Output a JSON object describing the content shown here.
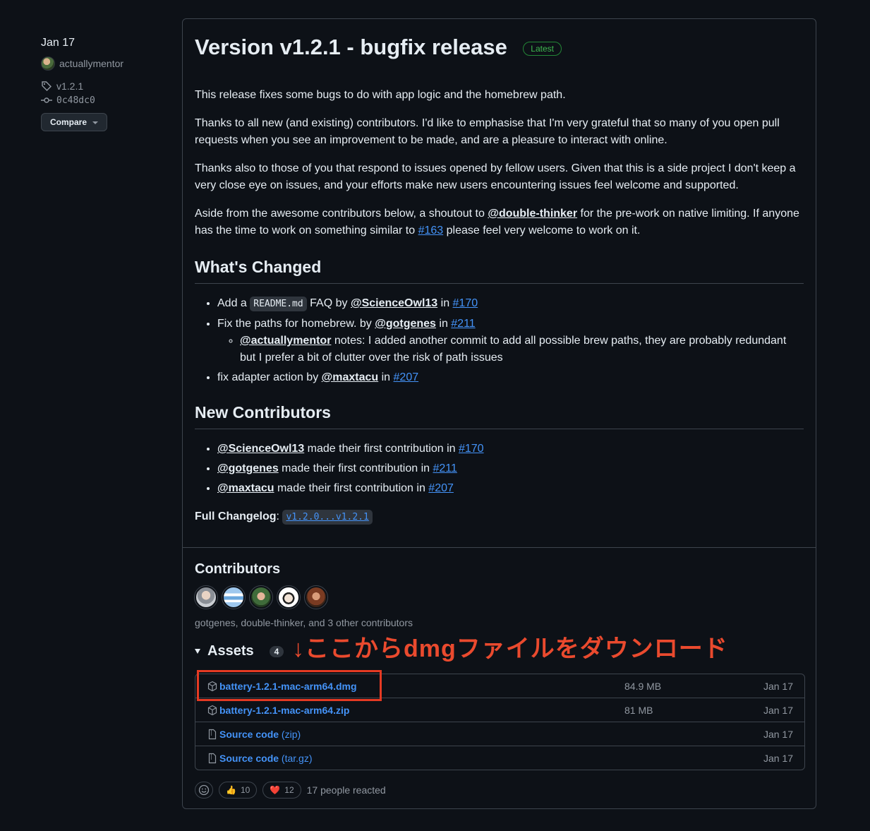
{
  "sidebar": {
    "date": "Jan 17",
    "author": "actuallymentor",
    "tag": "v1.2.1",
    "commit": "0c48dc0",
    "compare_label": "Compare"
  },
  "release": {
    "title": "Version v1.2.1 - bugfix release",
    "badge": "Latest",
    "p1": "This release fixes some bugs to do with app logic and the homebrew path.",
    "p2": "Thanks to all new (and existing) contributors. I'd like to emphasise that I'm very grateful that so many of you open pull requests when you see an improvement to be made, and are a pleasure to interact with online.",
    "p3": "Thanks also to those of you that respond to issues opened by fellow users. Given that this is a side project I don't keep a very close eye on issues, and your efforts make new users encountering issues feel welcome and supported.",
    "p4": {
      "a": "Aside from the awesome contributors below, a shoutout to ",
      "mention": "@double-thinker",
      "b": " for the pre-work on native limiting. If anyone has the time to work on something similar to ",
      "issue": "#163",
      "c": " please feel very welcome to work on it."
    },
    "whats_changed": {
      "heading": "What's Changed",
      "items": [
        {
          "pre": "Add a ",
          "code": "README.md",
          "mid": " FAQ by ",
          "user": "@ScienceOwl13",
          "in": " in ",
          "pr": "#170"
        },
        {
          "pre": "Fix the paths for homebrew. by ",
          "user": "@gotgenes",
          "in": " in ",
          "pr": "#211",
          "sub": {
            "user": "@actuallymentor",
            "text": " notes: I added another commit to add all possible brew paths, they are probably redundant but I prefer a bit of clutter over the risk of path issues"
          }
        },
        {
          "pre": "fix adapter action by ",
          "user": "@maxtacu",
          "in": " in ",
          "pr": "#207"
        }
      ]
    },
    "new_contributors": {
      "heading": "New Contributors",
      "items": [
        {
          "user": "@ScienceOwl13",
          "text": " made their first contribution in ",
          "pr": "#170"
        },
        {
          "user": "@gotgenes",
          "text": " made their first contribution in ",
          "pr": "#211"
        },
        {
          "user": "@maxtacu",
          "text": " made their first contribution in ",
          "pr": "#207"
        }
      ]
    },
    "changelog_label": "Full Changelog",
    "changelog_colon": ": ",
    "changelog_link": "v1.2.0...v1.2.1"
  },
  "contributors": {
    "heading": "Contributors",
    "summary": "gotgenes, double-thinker, and 3 other contributors"
  },
  "assets": {
    "heading": "Assets",
    "count": "4",
    "annotation": "↓ここからdmgファイルをダウンロード",
    "rows": [
      {
        "name": "battery-1.2.1-mac-arm64.dmg",
        "suffix": "",
        "size": "84.9 MB",
        "date": "Jan 17",
        "icon": "package-icon"
      },
      {
        "name": "battery-1.2.1-mac-arm64.zip",
        "suffix": "",
        "size": "81 MB",
        "date": "Jan 17",
        "icon": "package-icon"
      },
      {
        "name": "Source code",
        "suffix": " (zip)",
        "size": "",
        "date": "Jan 17",
        "icon": "file-zip-icon"
      },
      {
        "name": "Source code",
        "suffix": " (tar.gz)",
        "size": "",
        "date": "Jan 17",
        "icon": "file-zip-icon"
      }
    ]
  },
  "reactions": {
    "thumbs_emoji": "👍",
    "thumbs_count": "10",
    "heart_emoji": "❤️",
    "heart_count": "12",
    "summary": "17 people reacted"
  },
  "colors": {
    "background": "#0d1117",
    "link": "#4493f8",
    "latest_green": "#3fb950",
    "annotation_red": "#ea4a2e"
  }
}
